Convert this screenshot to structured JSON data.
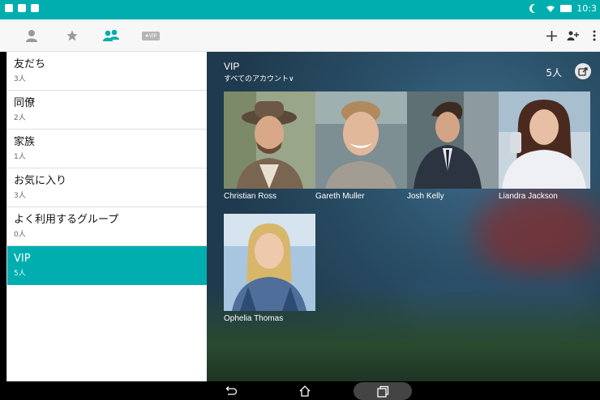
{
  "status": {
    "time": "10:3"
  },
  "toolbar": {
    "tabs": [
      {
        "icon": "person-icon"
      },
      {
        "icon": "star-icon"
      },
      {
        "icon": "group-icon",
        "active": true
      },
      {
        "icon": "vip-icon",
        "label": "★VIP"
      }
    ],
    "actions": [
      {
        "icon": "plus-icon"
      },
      {
        "icon": "add-group-icon"
      },
      {
        "icon": "more-icon"
      }
    ]
  },
  "groups": [
    {
      "name": "友だち",
      "count": "3人"
    },
    {
      "name": "同僚",
      "count": "2人"
    },
    {
      "name": "家族",
      "count": "1人"
    },
    {
      "name": "お気に入り",
      "count": "3人"
    },
    {
      "name": "よく利用するグループ",
      "count": "0人"
    },
    {
      "name": "VIP",
      "count": "5人",
      "active": true
    }
  ],
  "main": {
    "title": "VIP",
    "account_filter": "すべてのアカウント∨",
    "member_count": "5人",
    "contacts": [
      {
        "name": "Christian Ross"
      },
      {
        "name": "Gareth Muller"
      },
      {
        "name": "Josh Kelly"
      },
      {
        "name": "Liandra Jackson"
      },
      {
        "name": "Ophelia Thomas"
      }
    ]
  },
  "colors": {
    "accent": "#00aeb0"
  }
}
